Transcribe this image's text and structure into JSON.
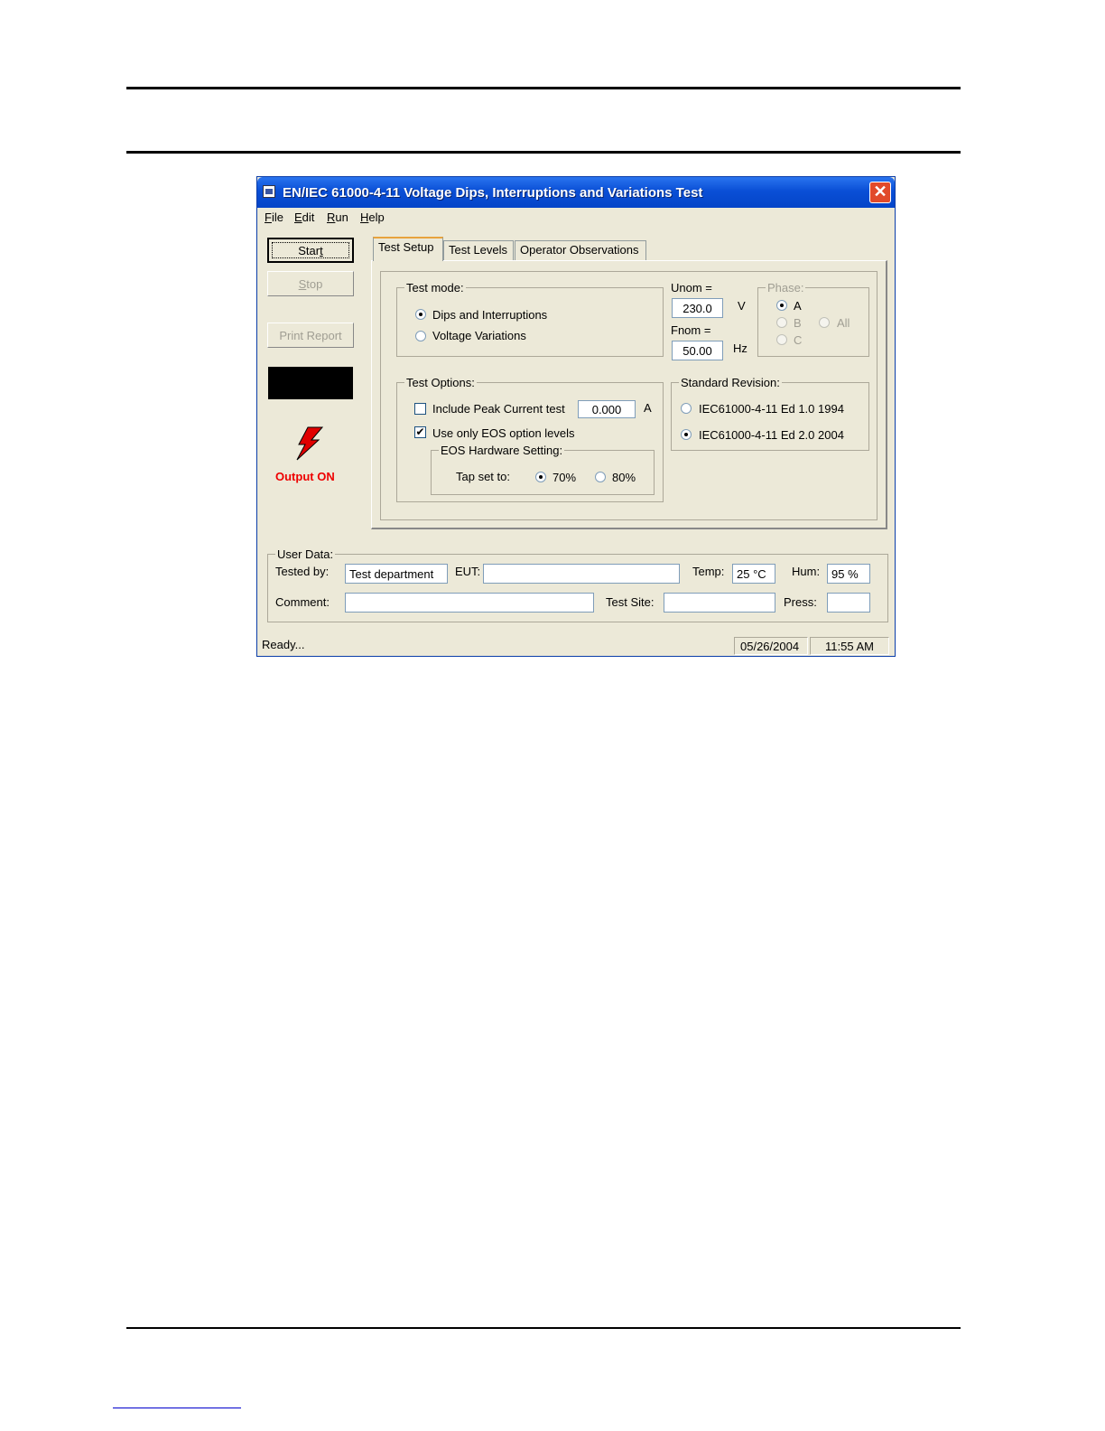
{
  "window": {
    "title": "EN/IEC 61000-4-11 Voltage Dips, Interruptions and Variations Test",
    "close_symbol": "✕"
  },
  "menu": {
    "file": {
      "hot": "F",
      "rest": "ile"
    },
    "edit": {
      "hot": "E",
      "rest": "dit"
    },
    "run": {
      "hot": "R",
      "rest": "un"
    },
    "help": {
      "hot": "H",
      "rest": "elp"
    }
  },
  "left": {
    "start": {
      "pre": "Star",
      "hot": "t"
    },
    "stop": {
      "hot": "S",
      "rest": "top"
    },
    "print_report": "Print Report",
    "output_status": "Output ON",
    "bolt_color": "#e00000"
  },
  "tabs": [
    "Test Setup",
    "Test Levels",
    "Operator Observations"
  ],
  "test_mode": {
    "label": "Test mode:",
    "options": [
      "Dips and Interruptions",
      "Voltage Variations"
    ],
    "selected": "Dips and Interruptions"
  },
  "unom": {
    "label": "Unom =",
    "value": "230.0",
    "unit": "V"
  },
  "fnom": {
    "label": "Fnom =",
    "value": "50.00",
    "unit": "Hz"
  },
  "phase": {
    "label": "Phase:",
    "options": [
      "A",
      "B",
      "C",
      "All"
    ],
    "selected": "A"
  },
  "test_options": {
    "label": "Test Options:",
    "peak_current": {
      "label": "Include Peak Current test",
      "checked": false,
      "value": "0.000",
      "unit": "A"
    },
    "eos_only": {
      "label": "Use only EOS option levels",
      "checked": true
    },
    "check_mark": "✔",
    "eos_hw": {
      "label": "EOS Hardware Setting:",
      "tap_label": "Tap set to:",
      "options": [
        "70%",
        "80%"
      ],
      "selected": "70%"
    }
  },
  "standard_revision": {
    "label": "Standard Revision:",
    "options": [
      "IEC61000-4-11 Ed 1.0 1994",
      "IEC61000-4-11 Ed 2.0 2004"
    ],
    "selected": "IEC61000-4-11 Ed 2.0 2004"
  },
  "user_data": {
    "label": "User Data:",
    "tested_by": {
      "label": "Tested by:",
      "value": "Test department"
    },
    "eut": {
      "label": "EUT:",
      "value": ""
    },
    "temp": {
      "label": "Temp:",
      "value": "25 °C"
    },
    "hum": {
      "label": "Hum:",
      "value": "95 %"
    },
    "comment": {
      "label": "Comment:",
      "value": ""
    },
    "test_site": {
      "label": "Test Site:",
      "value": ""
    },
    "press": {
      "label": "Press:",
      "value": ""
    }
  },
  "status": {
    "text": "Ready...",
    "date": "05/26/2004",
    "time": "11:55 AM"
  }
}
